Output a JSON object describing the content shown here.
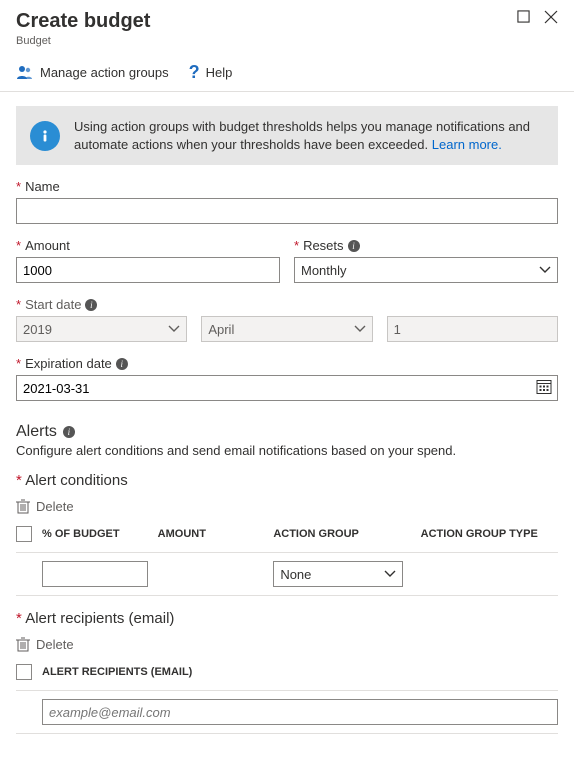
{
  "header": {
    "title": "Create budget",
    "subtitle": "Budget"
  },
  "commandBar": {
    "manageGroups": "Manage action groups",
    "help": "Help"
  },
  "infoBox": {
    "text": "Using action groups with budget thresholds helps you manage notifications and automate actions when your thresholds have been exceeded. ",
    "linkText": "Learn more."
  },
  "fields": {
    "nameLabel": "Name",
    "nameValue": "",
    "amountLabel": "Amount",
    "amountValue": "1000",
    "resetsLabel": "Resets",
    "resetsValue": "Monthly",
    "startDateLabel": "Start date",
    "startYear": "2019",
    "startMonth": "April",
    "startDay": "1",
    "expirationLabel": "Expiration date",
    "expirationValue": "2021-03-31"
  },
  "alerts": {
    "title": "Alerts",
    "description": "Configure alert conditions and send email notifications based on your spend.",
    "conditionsLabel": "Alert conditions",
    "deleteLabel": "Delete",
    "columns": {
      "pct": "% OF BUDGET",
      "amount": "AMOUNT",
      "actionGroup": "ACTION GROUP",
      "actionGroupType": "ACTION GROUP TYPE"
    },
    "rows": [
      {
        "pct": "",
        "amount": "",
        "actionGroup": "None",
        "actionGroupType": ""
      }
    ],
    "recipientsLabel": "Alert recipients (email)",
    "recipientsColumn": "ALERT RECIPIENTS (EMAIL)",
    "emailPlaceholder": "example@email.com"
  }
}
